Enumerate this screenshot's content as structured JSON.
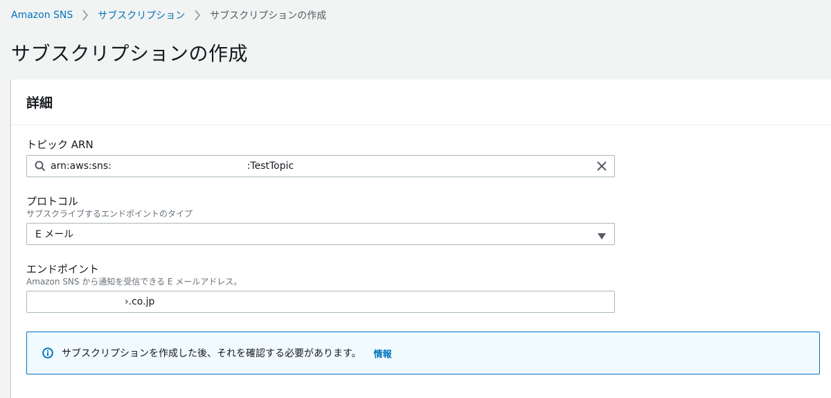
{
  "breadcrumb": {
    "items": [
      "Amazon SNS",
      "サブスクリプション"
    ],
    "current": "サブスクリプションの作成"
  },
  "page": {
    "title": "サブスクリプションの作成"
  },
  "panel": {
    "title": "詳細"
  },
  "topic_arn": {
    "label": "トピック ARN",
    "value": "arn:aws:sns:                                            :TestTopic"
  },
  "protocol": {
    "label": "プロトコル",
    "description": "サブスクライブするエンドポイントのタイプ",
    "selected": "E メール"
  },
  "endpoint": {
    "label": "エンドポイント",
    "description": "Amazon SNS から通知を受信できる E メールアドレス。",
    "value": "                             ›.co.jp"
  },
  "info_box": {
    "message": "サブスクリプションを作成した後、それを確認する必要があります。",
    "link": "情報"
  },
  "icons": {
    "breadcrumb_sep": "chevron-right-icon",
    "search": "search-icon",
    "clear": "close-icon",
    "dropdown": "caret-down-icon",
    "info": "info-circle-icon"
  },
  "colors": {
    "link": "#0073bb",
    "background": "#f2f3f3",
    "info_bg": "#f1faff"
  }
}
